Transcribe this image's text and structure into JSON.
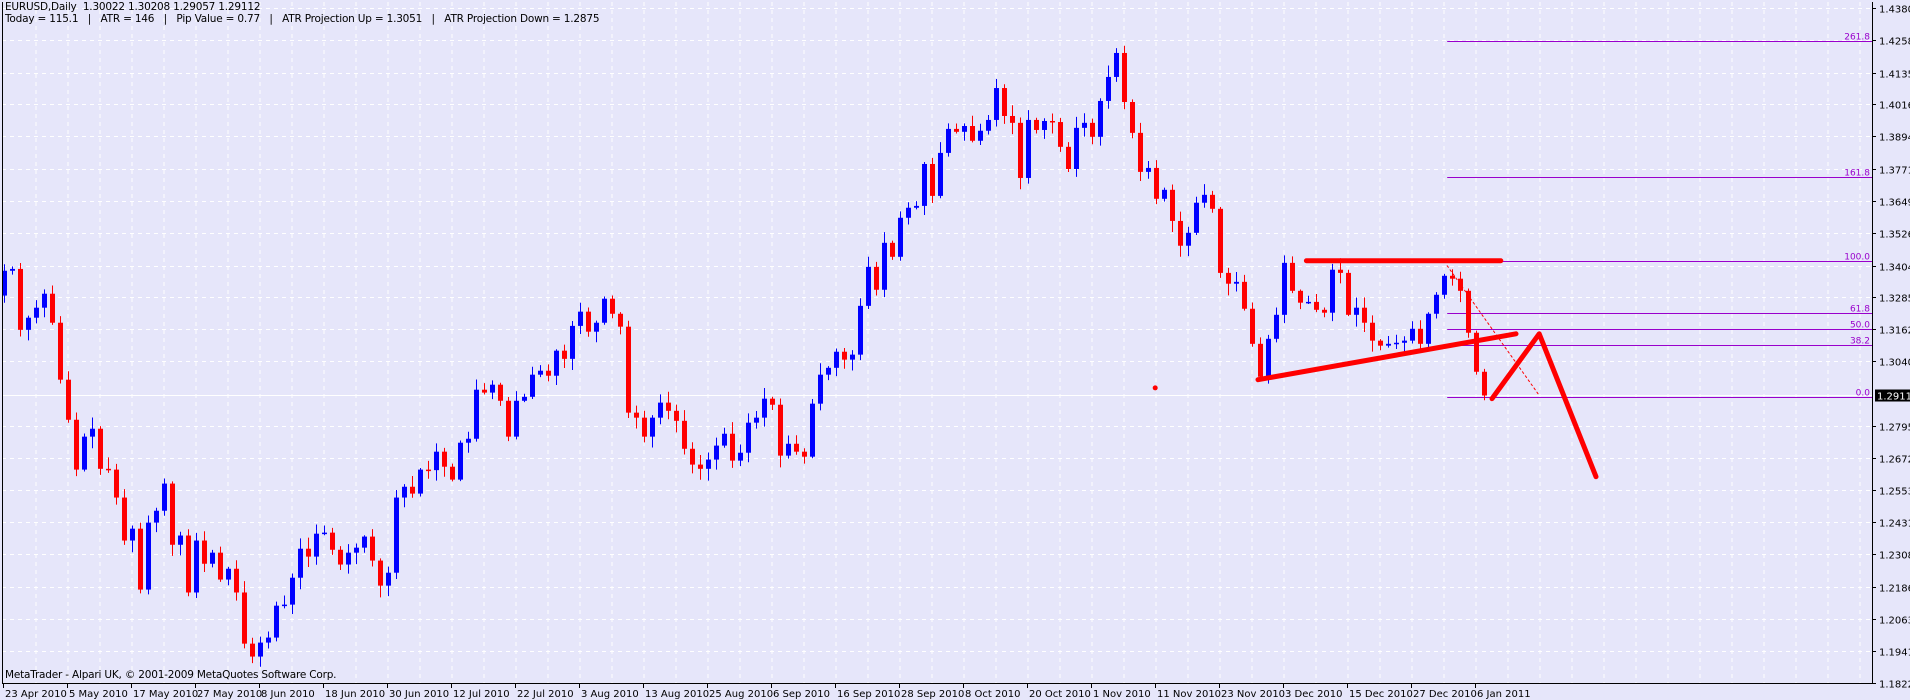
{
  "header": {
    "symbol_line": "EURUSD,Daily  1.30022 1.30208 1.29057 1.29112",
    "indicator_line": "Today = 115.1   |   ATR = 146   |   Pip Value = 0.77   |   ATR Projection Up = 1.3051   |   ATR Projection Down = 1.2875"
  },
  "footer": {
    "copyright": "MetaTrader - Alpari UK, © 2001-2009 MetaQuotes Software Corp."
  },
  "colors": {
    "background": "#E6E6FA",
    "bull": "#0000FF",
    "bear": "#FF0000",
    "grid": "#FFFFFF",
    "fib": "#9900CC",
    "drawing": "#FF0000"
  },
  "chart_data": {
    "type": "candlestick",
    "symbol": "EURUSD",
    "timeframe": "Daily",
    "current_price": "1.29112",
    "ylim": [
      1.1822,
      1.43805
    ],
    "price_ticks": [
      "1.43805",
      "1.42580",
      "1.41355",
      "1.40165",
      "1.38940",
      "1.37715",
      "1.36490",
      "1.35265",
      "1.34040",
      "1.32850",
      "1.31625",
      "1.30400",
      "1.27950",
      "1.26725",
      "1.25535",
      "1.24310",
      "1.23085",
      "1.21860",
      "1.20635",
      "1.19410",
      "1.18220"
    ],
    "date_ticks": [
      "23 Apr 2010",
      "5 May 2010",
      "17 May 2010",
      "27 May 2010",
      "8 Jun 2010",
      "18 Jun 2010",
      "30 Jun 2010",
      "12 Jul 2010",
      "22 Jul 2010",
      "3 Aug 2010",
      "13 Aug 2010",
      "25 Aug 2010",
      "6 Sep 2010",
      "16 Sep 2010",
      "28 Sep 2010",
      "8 Oct 2010",
      "20 Oct 2010",
      "1 Nov 2010",
      "11 Nov 2010",
      "23 Nov 2010",
      "3 Dec 2010",
      "15 Dec 2010",
      "27 Dec 2010",
      "6 Jan 2011"
    ],
    "bars_per_date_tick": 8,
    "first_open": 1.329,
    "closes": [
      1.3384,
      1.3391,
      1.316,
      1.3206,
      1.3244,
      1.3297,
      1.3187,
      1.2971,
      1.2819,
      1.263,
      1.2755,
      1.2785,
      1.2633,
      1.263,
      1.2524,
      1.2361,
      1.2406,
      1.2175,
      1.2429,
      1.2474,
      1.2577,
      1.2345,
      1.238,
      1.2164,
      1.2361,
      1.2273,
      1.2315,
      1.2213,
      1.2254,
      1.2164,
      1.197,
      1.1921,
      1.1974,
      1.1993,
      1.2114,
      1.2118,
      1.222,
      1.233,
      1.23,
      1.2387,
      1.2391,
      1.2326,
      1.227,
      1.2315,
      1.2334,
      1.2376,
      1.2285,
      1.219,
      1.2239,
      1.2524,
      1.2565,
      1.2539,
      1.263,
      1.2628,
      1.2698,
      1.2641,
      1.2592,
      1.2732,
      1.2747,
      1.2933,
      1.2922,
      1.2952,
      1.2891,
      1.2755,
      1.2891,
      1.2906,
      1.299,
      1.3005,
      1.2986,
      1.3081,
      1.305,
      1.3175,
      1.3229,
      1.3153,
      1.3187,
      1.3278,
      1.3221,
      1.3172,
      1.2846,
      1.2827,
      1.2755,
      1.2827,
      1.2884,
      1.2853,
      1.2815,
      1.2709,
      1.2649,
      1.2633,
      1.2668,
      1.2721,
      1.2766,
      1.2664,
      1.2694,
      1.2808,
      1.2827,
      1.2899,
      1.2876,
      1.2683,
      1.2728,
      1.2698,
      1.2679,
      1.288,
      1.299,
      1.3016,
      1.3077,
      1.3047,
      1.3066,
      1.3251,
      1.3399,
      1.3312,
      1.349,
      1.3437,
      1.3585,
      1.3623,
      1.363,
      1.3789,
      1.3668,
      1.3831,
      1.3922,
      1.3911,
      1.3933,
      1.3877,
      1.3915,
      1.3956,
      1.4077,
      1.3971,
      1.3945,
      1.3736,
      1.3956,
      1.3918,
      1.3952,
      1.3948,
      1.3854,
      1.377,
      1.3926,
      1.3945,
      1.3892,
      1.4028,
      1.4119,
      1.421,
      1.4024,
      1.3907,
      1.3759,
      1.3774,
      1.3657,
      1.3691,
      1.3573,
      1.3479,
      1.3528,
      1.3642,
      1.3672,
      1.3619,
      1.3376,
      1.3335,
      1.3342,
      1.324,
      1.3107,
      1.2982,
      1.3126,
      1.3217,
      1.3414,
      1.3308,
      1.3263,
      1.3266,
      1.3236,
      1.3225,
      1.3388,
      1.3376,
      1.3217,
      1.3244,
      1.3187,
      1.3119,
      1.31,
      1.3107,
      1.3111,
      1.3119,
      1.3164,
      1.3107,
      1.3221,
      1.3293,
      1.3365,
      1.3354,
      1.3308,
      1.3149,
      1.3001,
      1.2911
    ],
    "fibonacci": {
      "start_bar": 180.4,
      "levels": [
        {
          "label": "261.8",
          "price": 1.4254
        },
        {
          "label": "161.8",
          "price": 1.3739
        },
        {
          "label": "100.0",
          "price": 1.3422
        },
        {
          "label": "61.8",
          "price": 1.3224
        },
        {
          "label": "50.0",
          "price": 1.3164
        },
        {
          "label": "38.2",
          "price": 1.3103
        },
        {
          "label": "0.0",
          "price": 1.2906
        }
      ]
    },
    "drawings": {
      "resistance_line": [
        [
          162.8,
          1.3422
        ],
        [
          187.1,
          1.3422
        ]
      ],
      "support_trendline": [
        [
          156.75,
          1.2971
        ],
        [
          189.0,
          1.3145
        ]
      ],
      "projection_zigzag": [
        [
          186.0,
          1.2899
        ],
        [
          191.9,
          1.3145
        ],
        [
          199.0,
          1.2603
        ]
      ],
      "fib_base_dotted": [
        [
          180.4,
          1.3403
        ],
        [
          191.75,
          1.2918
        ]
      ],
      "marker_dot": [
        143.9,
        1.294
      ]
    }
  }
}
